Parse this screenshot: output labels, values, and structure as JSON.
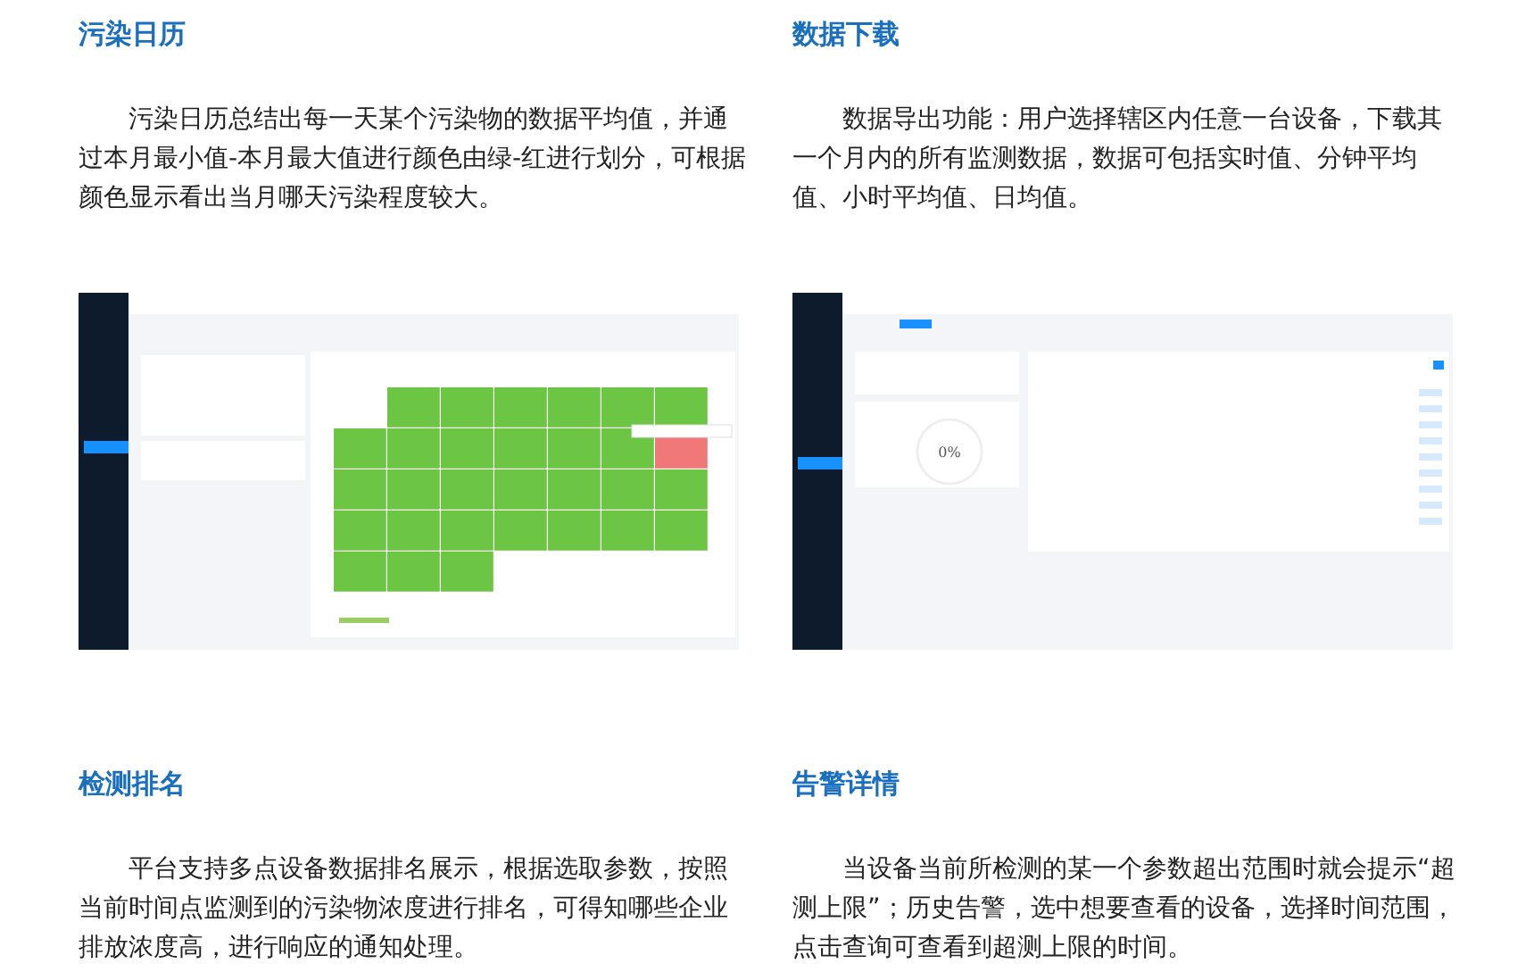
{
  "sections": [
    {
      "title": "污染日历",
      "text": "污染日历总结出每一天某个污染物的数据平均值，并通过本月最小值-本月最大值进行颜色由绿-红进行划分，可根据颜色显示看出当月哪天污染程度较大。",
      "screen": {
        "kind": "calendar",
        "cells": [
          {
            "kind": "blank"
          },
          {
            "kind": "day",
            "color": "#6cc644"
          },
          {
            "kind": "day",
            "color": "#6cc644"
          },
          {
            "kind": "day",
            "color": "#6cc644"
          },
          {
            "kind": "day",
            "color": "#6cc644"
          },
          {
            "kind": "day",
            "color": "#6cc644"
          },
          {
            "kind": "day",
            "color": "#6cc644"
          },
          {
            "kind": "day",
            "color": "#6cc644"
          },
          {
            "kind": "day",
            "color": "#6cc644"
          },
          {
            "kind": "day",
            "color": "#6cc644"
          },
          {
            "kind": "day",
            "color": "#6cc644"
          },
          {
            "kind": "day",
            "color": "#6cc644"
          },
          {
            "kind": "day",
            "color": "#6cc644"
          },
          {
            "kind": "day",
            "color": "#f07878"
          },
          {
            "kind": "day",
            "color": "#6cc644"
          },
          {
            "kind": "day",
            "color": "#6cc644"
          },
          {
            "kind": "day",
            "color": "#6cc644"
          },
          {
            "kind": "day",
            "color": "#6cc644"
          },
          {
            "kind": "day",
            "color": "#6cc644"
          },
          {
            "kind": "day",
            "color": "#6cc644"
          },
          {
            "kind": "day",
            "color": "#6cc644"
          },
          {
            "kind": "day",
            "color": "#6cc644"
          },
          {
            "kind": "day",
            "color": "#6cc644"
          },
          {
            "kind": "day",
            "color": "#6cc644"
          },
          {
            "kind": "day",
            "color": "#6cc644"
          },
          {
            "kind": "day",
            "color": "#6cc644"
          },
          {
            "kind": "day",
            "color": "#6cc644"
          },
          {
            "kind": "day",
            "color": "#6cc644"
          },
          {
            "kind": "day",
            "color": "#6cc644"
          },
          {
            "kind": "day",
            "color": "#6cc644"
          },
          {
            "kind": "day",
            "color": "#6cc644"
          }
        ]
      }
    },
    {
      "title": "数据下载",
      "text": "数据导出功能：用户选择辖区内任意一台设备，下载其一个月内的所有监测数据，数据可包括实时值、分钟平均值、小时平均值、日均值。",
      "screen": {
        "kind": "download",
        "progress": "0%"
      }
    },
    {
      "title": "检测排名",
      "text": "平台支持多点设备数据排名展示，根据选取参数，按照当前时间点监测到的污染物浓度进行排名，可得知哪些企业排放浓度高，进行响应的通知处理。"
    },
    {
      "title": "告警详情",
      "text": "当设备当前所检测的某一个参数超出范围时就会提示“超测上限”；历史告警，选中想要查看的设备，选择时间范围，点击查询可查看到超测上限的时间。"
    }
  ]
}
